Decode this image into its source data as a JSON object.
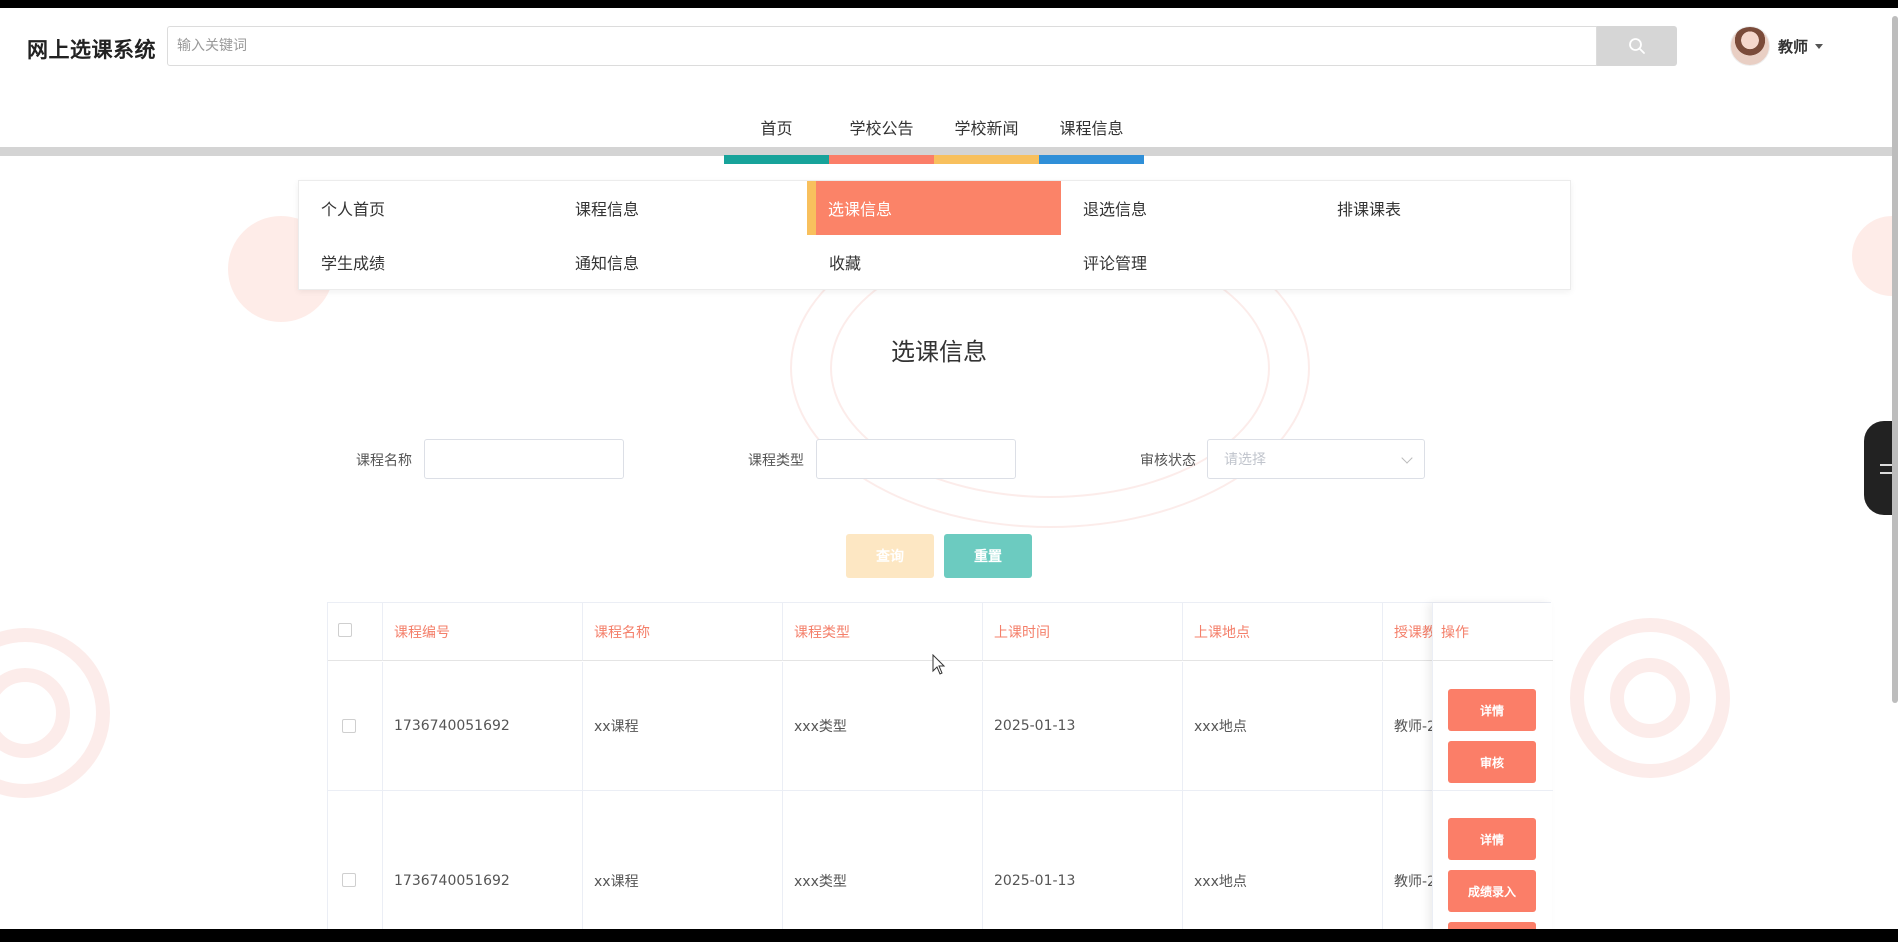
{
  "header": {
    "logo": "网上选课系统",
    "search_placeholder": "输入关键词",
    "user_name": "教师"
  },
  "topnav": {
    "items": [
      {
        "label": "首页",
        "color": "#17a39a"
      },
      {
        "label": "学校公告",
        "color": "#fb7e68"
      },
      {
        "label": "学校新闻",
        "color": "#f8c05d"
      },
      {
        "label": "课程信息",
        "color": "#2f8fd8"
      }
    ]
  },
  "menu": {
    "items": [
      {
        "label": "个人首页"
      },
      {
        "label": "课程信息"
      },
      {
        "label": "选课信息",
        "active": true
      },
      {
        "label": "退选信息"
      },
      {
        "label": "排课课表"
      },
      {
        "label": "学生成绩"
      },
      {
        "label": "通知信息"
      },
      {
        "label": "收藏"
      },
      {
        "label": "评论管理"
      }
    ]
  },
  "section_title": "选课信息",
  "filters": {
    "course_name_label": "课程名称",
    "course_type_label": "课程类型",
    "audit_status_label": "审核状态",
    "audit_status_placeholder": "请选择"
  },
  "buttons": {
    "query": "查询",
    "reset": "重置"
  },
  "table": {
    "columns": [
      "课程编号",
      "课程名称",
      "课程类型",
      "上课时间",
      "上课地点",
      "授课教"
    ],
    "op_header": "操作",
    "rows": [
      {
        "cells": [
          "1736740051692",
          "xx课程",
          "xxx类型",
          "2025-01-13",
          "xxx地点",
          "教师-2"
        ],
        "actions": [
          "详情",
          "审核"
        ]
      },
      {
        "cells": [
          "1736740051692",
          "xx课程",
          "xxx类型",
          "2025-01-13",
          "xxx地点",
          "教师-2"
        ],
        "actions": [
          "详情",
          "成绩录入"
        ]
      }
    ]
  }
}
